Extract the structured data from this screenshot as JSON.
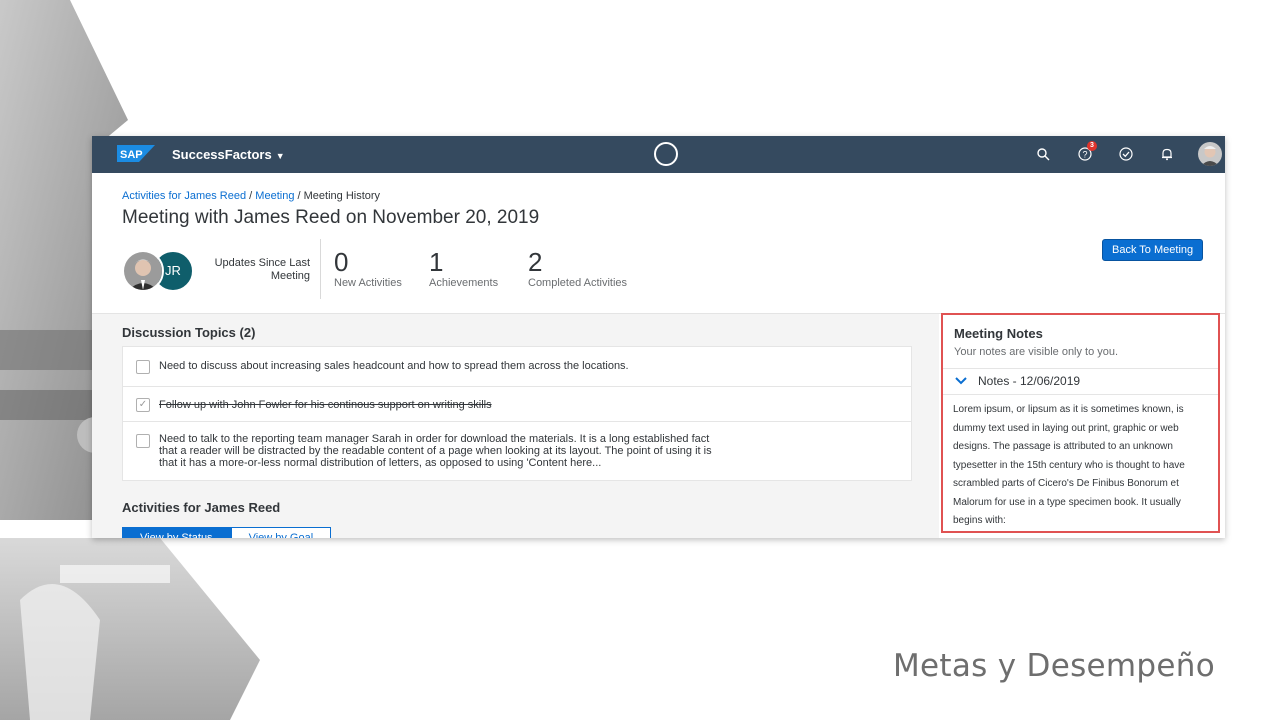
{
  "slide": {
    "caption": "Metas y Desempeño"
  },
  "shell": {
    "logo": "SAP",
    "product": "SuccessFactors",
    "icons": [
      "search-icon",
      "help-icon",
      "approvals-icon",
      "notifications-icon"
    ],
    "help_badge": "3",
    "color": "#354a5f"
  },
  "header": {
    "breadcrumb": [
      {
        "label": "Activities for James Reed",
        "link": true
      },
      {
        "label": "Meeting",
        "link": true
      },
      {
        "label": "Meeting History",
        "link": false
      }
    ],
    "title": "Meeting with James Reed on November 20, 2019",
    "avatar_initials": "JR",
    "updates_label": "Updates Since Last Meeting",
    "kpis": [
      {
        "value": "0",
        "label": "New Activities"
      },
      {
        "value": "1",
        "label": "Achievements"
      },
      {
        "value": "2",
        "label": "Completed Activities"
      }
    ],
    "back_button": "Back To Meeting"
  },
  "discussion": {
    "title": "Discussion Topics (2)",
    "topics": [
      {
        "text": "Need to discuss about increasing sales headcount and how to spread them across the locations.",
        "checked": false
      },
      {
        "text": "Follow up with John Fowler for his continous support on writing skills",
        "checked": true
      },
      {
        "lines": [
          "Need to talk to the reporting team manager Sarah in order for download the materials. It is a long established fact",
          "that a reader will be distracted by the readable content of a page when looking at its layout. The point of using it is",
          "that it has a more-or-less normal distribution of letters, as opposed to using 'Content here..."
        ],
        "checked": false
      }
    ]
  },
  "activities": {
    "title": "Activities for James Reed",
    "view_by_status": "View by Status",
    "view_by_goal": "View by Goal"
  },
  "notes": {
    "title": "Meeting Notes",
    "subtitle": "Your notes are visible only to you.",
    "date_header": "Notes - 12/06/2019",
    "body_lines": [
      "Lorem ipsum, or lipsum as it is sometimes known, is",
      "dummy text used in laying out print, graphic or web",
      "designs. The passage is attributed to an unknown",
      "typesetter in the 15th century who is thought to have",
      "scrambled parts of Cicero's De Finibus Bonorum et",
      "Malorum for use in a type specimen book. It usually",
      "begins with:"
    ],
    "highlight_color": "#e05252"
  },
  "colors": {
    "accent": "#0a6ed1",
    "avatar_bg": "#0f5e6b"
  }
}
